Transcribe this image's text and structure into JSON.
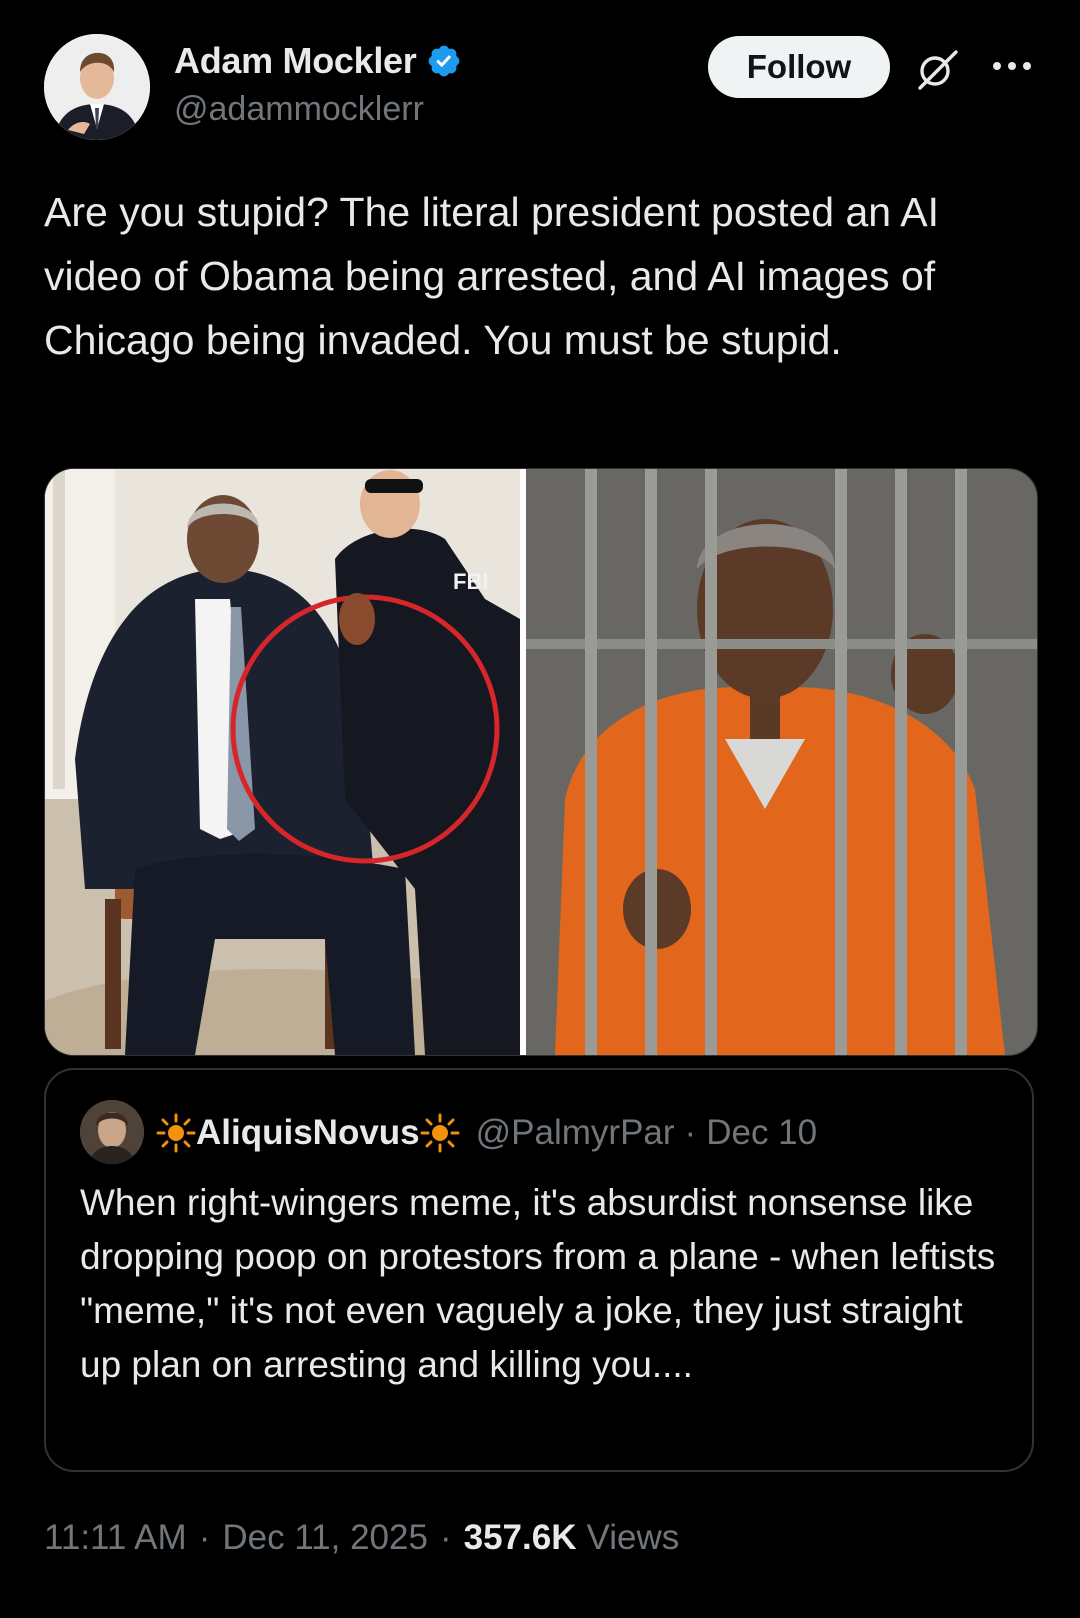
{
  "author": {
    "display_name": "Adam Mockler",
    "handle": "@adammocklerr",
    "verified": true
  },
  "actions": {
    "follow_label": "Follow"
  },
  "post": {
    "text": "Are you stupid? The literal president posted an AI video of Obama being arrested, and AI images of Chicago being invaded. You must be stupid."
  },
  "media": {
    "left_image": {
      "description_icon": "photo",
      "overlay_text": "FBI"
    },
    "right_image": {
      "description_icon": "photo"
    }
  },
  "quote": {
    "display_name": "AliquisNovus",
    "handle": "@PalmyrPar",
    "separator": "·",
    "date": "Dec 10",
    "text": "When right-wingers meme, it's absurdist nonsense like dropping poop on protestors from a plane - when leftists \"meme,\" it's not even vaguely a joke, they just straight up plan on arresting and killing you...."
  },
  "meta": {
    "time": "11:11 AM",
    "separator": "·",
    "date": "Dec 11, 2025",
    "views_count": "357.6K",
    "views_label": "Views"
  },
  "colors": {
    "background": "#000000",
    "text_primary": "#e7e9ea",
    "text_secondary": "#71767b",
    "verified_blue": "#1d9bf0",
    "border": "#2f3336",
    "sun_orange": "#f4900c"
  }
}
